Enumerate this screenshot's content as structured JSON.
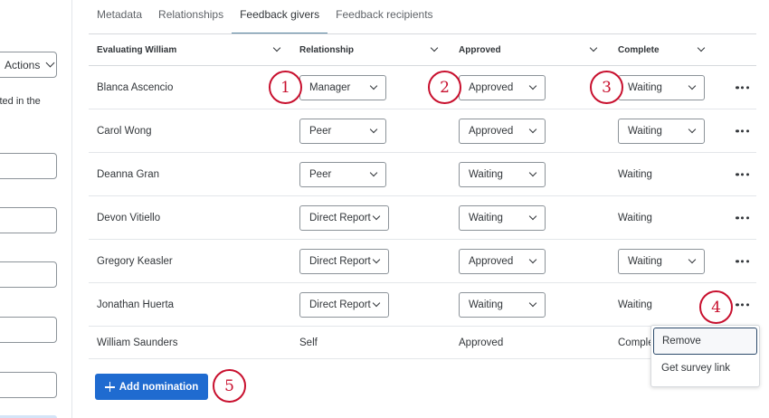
{
  "left_panel": {
    "actions_label": "Actions",
    "text_fragment": "cted in the"
  },
  "tabs": [
    "Metadata",
    "Relationships",
    "Feedback givers",
    "Feedback recipients"
  ],
  "table": {
    "headers": {
      "evaluator": "Evaluating William",
      "relationship": "Relationship",
      "approved": "Approved",
      "complete": "Complete"
    },
    "rows": [
      {
        "name": "Blanca Ascencio",
        "relationship": "Manager",
        "relationship_select": true,
        "approved": "Approved",
        "approved_select": true,
        "complete": "Waiting",
        "complete_select": true
      },
      {
        "name": "Carol Wong",
        "relationship": "Peer",
        "relationship_select": true,
        "approved": "Approved",
        "approved_select": true,
        "complete": "Waiting",
        "complete_select": true
      },
      {
        "name": "Deanna Gran",
        "relationship": "Peer",
        "relationship_select": true,
        "approved": "Waiting",
        "approved_select": true,
        "complete": "Waiting",
        "complete_select": false
      },
      {
        "name": "Devon Vitiello",
        "relationship": "Direct Report",
        "relationship_select": true,
        "approved": "Waiting",
        "approved_select": true,
        "complete": "Waiting",
        "complete_select": false
      },
      {
        "name": "Gregory Keasler",
        "relationship": "Direct Report",
        "relationship_select": true,
        "approved": "Approved",
        "approved_select": true,
        "complete": "Waiting",
        "complete_select": true
      },
      {
        "name": "Jonathan Huerta",
        "relationship": "Direct Report",
        "relationship_select": true,
        "approved": "Waiting",
        "approved_select": true,
        "complete": "Waiting",
        "complete_select": false
      },
      {
        "name": "William Saunders",
        "relationship": "Self",
        "relationship_select": false,
        "approved": "Approved",
        "approved_select": false,
        "complete": "Complete",
        "complete_select": false
      }
    ]
  },
  "add_button_label": "Add nomination",
  "context_menu": [
    "Remove",
    "Get survey link"
  ],
  "callouts": [
    "1",
    "2",
    "3",
    "4",
    "5"
  ],
  "colors": {
    "primary": "#1f6bd0",
    "callout": "#c8102e",
    "tab_underline": "#5f8aa4"
  }
}
